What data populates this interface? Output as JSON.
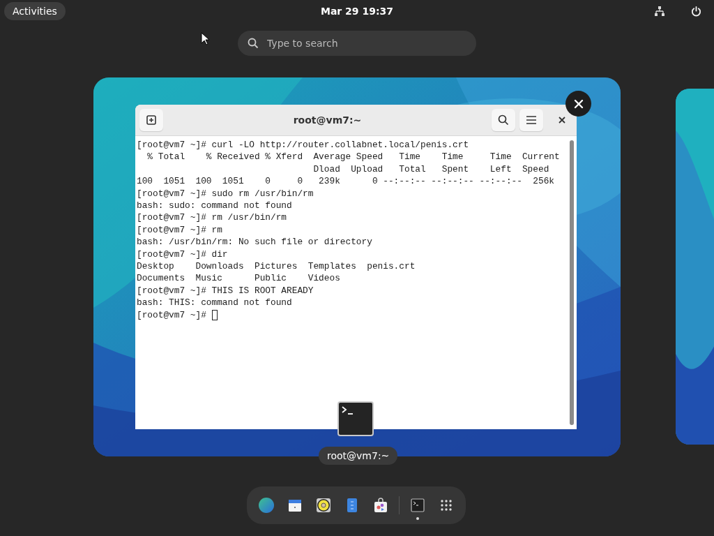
{
  "top_bar": {
    "activities": "Activities",
    "clock": "Mar 29  19:37"
  },
  "search": {
    "placeholder": "Type to search"
  },
  "window": {
    "title": "root@vm7:~",
    "caption": "root@vm7:~",
    "lines": [
      "[root@vm7 ~]# curl -LO http://router.collabnet.local/penis.crt",
      "  % Total    % Received % Xferd  Average Speed   Time    Time     Time  Current",
      "                                 Dload  Upload   Total   Spent    Left  Speed",
      "100  1051  100  1051    0     0   239k      0 --:--:-- --:--:-- --:--:--  256k",
      "[root@vm7 ~]# sudo rm /usr/bin/rm",
      "bash: sudo: command not found",
      "[root@vm7 ~]# rm /usr/bin/rm",
      "[root@vm7 ~]# rm",
      "bash: /usr/bin/rm: No such file or directory",
      "[root@vm7 ~]# dir",
      "Desktop    Downloads  Pictures  Templates  penis.crt",
      "Documents  Music      Public    Videos",
      "[root@vm7 ~]# THIS IS ROOT AREADY",
      "bash: THIS: command not found"
    ],
    "prompt": "[root@vm7 ~]# "
  },
  "dock": [
    {
      "kind": "browser",
      "running": false
    },
    {
      "kind": "calendar",
      "running": false
    },
    {
      "kind": "music",
      "running": false
    },
    {
      "kind": "files",
      "running": false
    },
    {
      "kind": "software",
      "running": false
    },
    {
      "kind": "separator"
    },
    {
      "kind": "terminal",
      "running": true
    },
    {
      "kind": "apps",
      "running": false
    }
  ]
}
